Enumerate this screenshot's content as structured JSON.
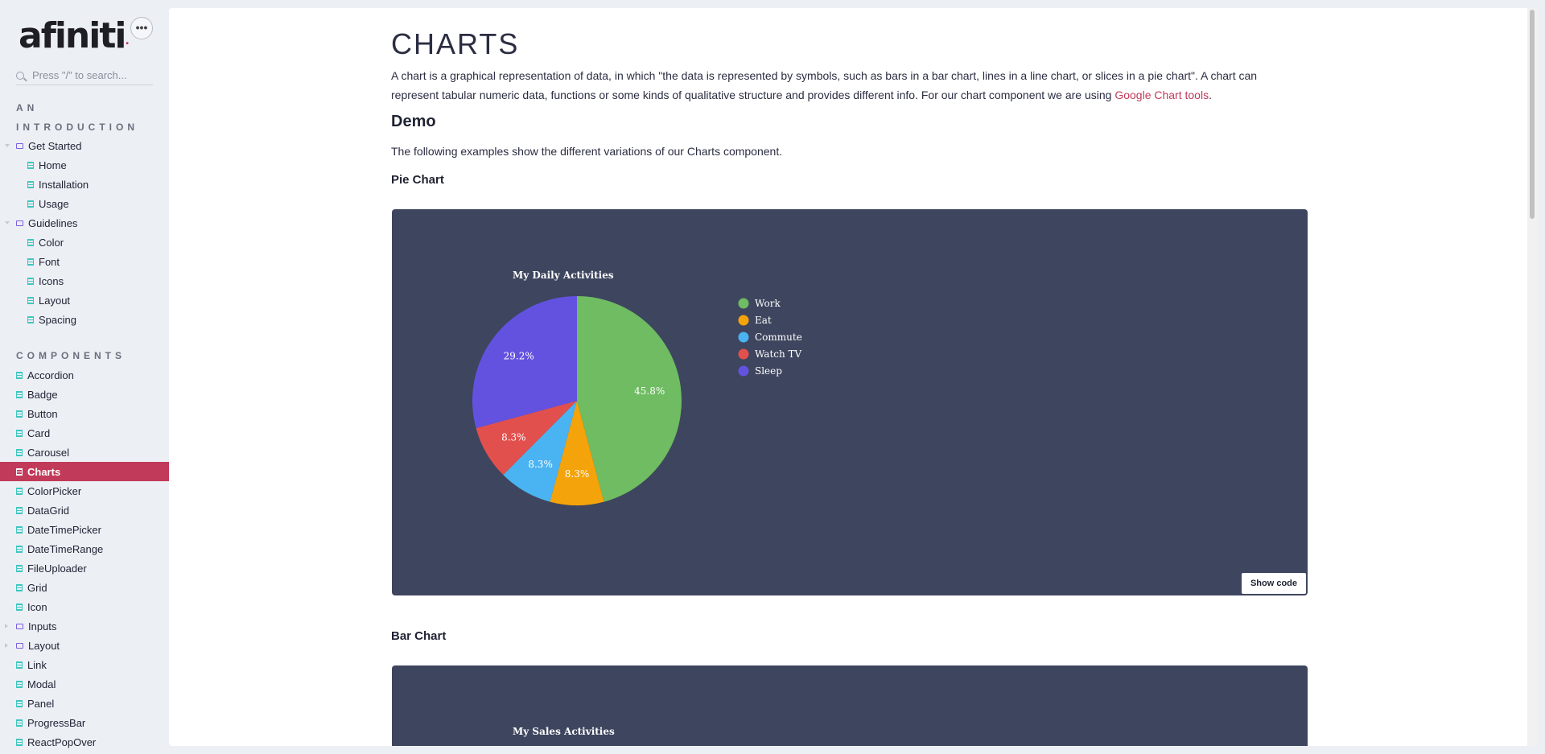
{
  "sidebar": {
    "logo": "afiniti",
    "logo_dot": ".",
    "more_icon": "ellipsis-icon",
    "search": {
      "placeholder": "Press \"/\" to search...",
      "icon": "search-icon"
    },
    "section_intro_line1": "AN",
    "section_intro_line2": "INTRODUCTION",
    "section_components": "COMPONENTS",
    "intro_items": [
      {
        "label": "Get Started",
        "type": "folder"
      },
      {
        "label": "Home",
        "type": "doc"
      },
      {
        "label": "Installation",
        "type": "doc"
      },
      {
        "label": "Usage",
        "type": "doc"
      },
      {
        "label": "Guidelines",
        "type": "folder"
      },
      {
        "label": "Color",
        "type": "doc"
      },
      {
        "label": "Font",
        "type": "doc"
      },
      {
        "label": "Icons",
        "type": "doc"
      },
      {
        "label": "Layout",
        "type": "doc"
      },
      {
        "label": "Spacing",
        "type": "doc"
      }
    ],
    "component_items": [
      {
        "label": "Accordion",
        "type": "doc"
      },
      {
        "label": "Badge",
        "type": "doc"
      },
      {
        "label": "Button",
        "type": "doc"
      },
      {
        "label": "Card",
        "type": "doc"
      },
      {
        "label": "Carousel",
        "type": "doc"
      },
      {
        "label": "Charts",
        "type": "doc",
        "active": true
      },
      {
        "label": "ColorPicker",
        "type": "doc"
      },
      {
        "label": "DataGrid",
        "type": "doc"
      },
      {
        "label": "DateTimePicker",
        "type": "doc"
      },
      {
        "label": "DateTimeRange",
        "type": "doc"
      },
      {
        "label": "FileUploader",
        "type": "doc"
      },
      {
        "label": "Grid",
        "type": "doc"
      },
      {
        "label": "Icon",
        "type": "doc"
      },
      {
        "label": "Inputs",
        "type": "folder"
      },
      {
        "label": "Layout",
        "type": "folder"
      },
      {
        "label": "Link",
        "type": "doc"
      },
      {
        "label": "Modal",
        "type": "doc"
      },
      {
        "label": "Panel",
        "type": "doc"
      },
      {
        "label": "ProgressBar",
        "type": "doc"
      },
      {
        "label": "ReactPopOver",
        "type": "doc"
      }
    ]
  },
  "main": {
    "title": "CHARTS",
    "intro_text": "A chart is a graphical representation of data, in which \"the data is represented by symbols, such as bars in a bar chart, lines in a line chart, or slices in a pie chart\". A chart can represent tabular numeric data, functions or some kinds of qualitative structure and provides different info. For our chart component we are using ",
    "intro_link": "Google Chart tools",
    "intro_end": ".",
    "demo_heading": "Demo",
    "demo_desc": "The following examples show the different variations of our Charts component.",
    "pie_heading": "Pie Chart",
    "bar_heading": "Bar Chart",
    "show_code": "Show code"
  },
  "chart_data": [
    {
      "type": "pie",
      "title": "My Daily Activities",
      "legend_position": "right",
      "slices": [
        {
          "label": "Work",
          "value": 45.8,
          "color": "#6fbc62"
        },
        {
          "label": "Eat",
          "value": 8.3,
          "color": "#f5a30a"
        },
        {
          "label": "Commute",
          "value": 8.3,
          "color": "#4ab3f2"
        },
        {
          "label": "Watch TV",
          "value": 8.3,
          "color": "#e2504d"
        },
        {
          "label": "Sleep",
          "value": 29.2,
          "color": "#6352e0"
        }
      ],
      "value_labels": [
        "45.8%",
        "8.3%",
        "8.3%",
        "8.3%",
        "29.2%"
      ]
    },
    {
      "type": "bar",
      "title": "My Sales Activities"
    }
  ],
  "colors": {
    "accent": "#c23a5a",
    "chart_bg": "#3e455e",
    "doc_icon": "#3ec6c1",
    "folder_icon": "#7b5fe0"
  }
}
